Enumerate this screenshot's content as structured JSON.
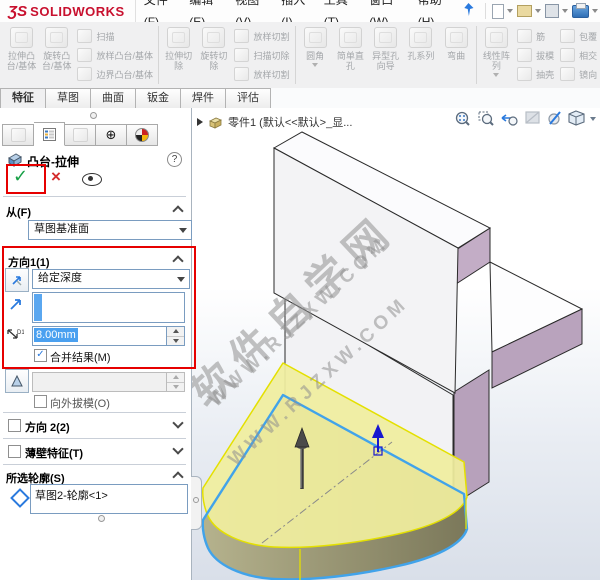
{
  "titlebar": {
    "logo_glyph": "ƷS",
    "logo_text": "SOLIDWORKS",
    "menu": [
      "文件(F)",
      "编辑(E)",
      "视图(V)",
      "插入(I)",
      "工具(T)",
      "窗口(W)",
      "帮助(H)"
    ]
  },
  "ribbon": {
    "group1": {
      "big1": "拉伸凸台/基体",
      "big2": "旋转凸台/基体",
      "small": [
        "扫描",
        "放样凸台/基体",
        "边界凸台/基体"
      ]
    },
    "group2": {
      "big1": "拉伸切除",
      "big2": "旋转切除",
      "small": [
        "放样切割",
        "扫描切除",
        "放样切割"
      ]
    },
    "group3": {
      "items": [
        "圆角",
        "简单直孔",
        "异型孔向导",
        "孔系列",
        "弯曲"
      ]
    },
    "group4": {
      "big1": "线性阵列",
      "small": [
        "筋",
        "拔模",
        "抽壳"
      ],
      "small2": [
        "包覆",
        "相交",
        "镜向"
      ]
    }
  },
  "tabs": {
    "items": [
      "特征",
      "草图",
      "曲面",
      "钣金",
      "焊件",
      "评估"
    ],
    "active": "特征"
  },
  "pm": {
    "title": "凸台-拉伸",
    "help": "?",
    "ok": "✓",
    "cancel": "×",
    "from_label": "从(F)",
    "from_value": "草图基准面",
    "dir1_label": "方向1(1)",
    "end_condition": "给定深度",
    "depth_value": "8.00mm",
    "merge_label": "合并结果(M)",
    "draft_out_label": "向外拔模(O)",
    "dir2_label": "方向 2(2)",
    "thin_label": "薄壁特征(T)",
    "contour_label": "所选轮廓(S)",
    "contour_value": "草图2-轮廓<1>"
  },
  "viewport": {
    "tree_label": "零件1 (默认<<默认>_显...",
    "watermark_text": "软件自学网",
    "watermark_url": "WWW.RJZXW.COM"
  },
  "colors": {
    "annotation_red": "#e60000",
    "selection_blue": "#4aa0f0",
    "preview_yellow": "#f0ee9e",
    "side_olive": "#8f8c6b",
    "edge_blue": "#41a3ea",
    "purple_face": "#c3adc6",
    "check_green": "#17a046",
    "brand_red": "#c8102e"
  }
}
